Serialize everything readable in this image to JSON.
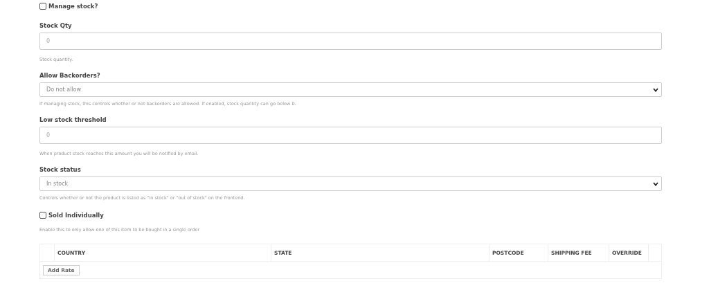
{
  "fields": [
    {
      "kind": "checkbox",
      "label": "Manage stock?",
      "checked": false
    },
    {
      "kind": "input",
      "label": "Stock Qty",
      "placeholder": "0",
      "help": "Stock quantity."
    },
    {
      "kind": "select",
      "label": "Allow Backorders?",
      "value": "Do not allow",
      "help": "If managing stock, this controls whether or not backorders are allowed. If enabled, stock quantity can go below 0."
    },
    {
      "kind": "input",
      "label": "Low stock threshold",
      "placeholder": "0",
      "help": "When product stock reaches this amount you will be notified by email."
    },
    {
      "kind": "select",
      "label": "Stock status",
      "value": "In stock",
      "help": "Controls whether or not the product is listed as \"in stock\" or \"out of stock\" on the frontend."
    },
    {
      "kind": "checkbox",
      "label": "Sold Individually",
      "checked": false,
      "help": "Enable this to only allow one of this item to be bought in a single order"
    }
  ],
  "rates_table": {
    "columns": [
      "COUNTRY",
      "STATE",
      "POSTCODE",
      "SHIPPING FEE",
      "OVERRIDE"
    ],
    "add_button": "Add Rate"
  }
}
